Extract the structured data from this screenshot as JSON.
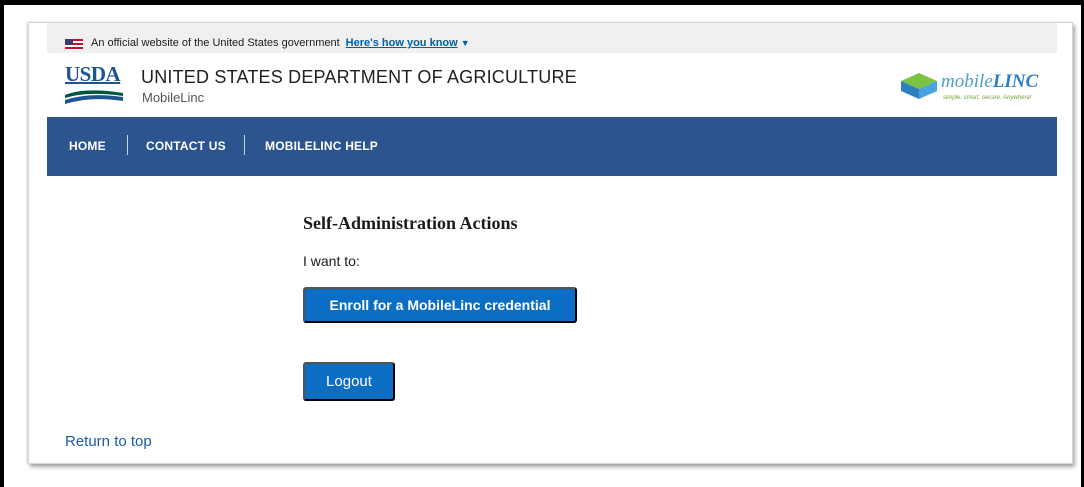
{
  "banner": {
    "text": "An official website of the United States government",
    "link": "Here's how you know",
    "flag_icon": "us-flag-icon"
  },
  "header": {
    "logo_text": "USDA",
    "agency_name": "UNITED STATES DEPARTMENT OF AGRICULTURE",
    "agency_sub": "MobileLinc",
    "brand_logo": {
      "name_part1": "mobile",
      "name_part2": "LINC",
      "tagline": "simple. smart. secure. Anywhere!"
    }
  },
  "nav": {
    "items": [
      {
        "label": "HOME"
      },
      {
        "label": "CONTACT US"
      },
      {
        "label": "MOBILELINC HELP"
      }
    ]
  },
  "main": {
    "title": "Self-Administration Actions",
    "prompt": "I want to:",
    "enroll_button": "Enroll for a MobileLinc credential",
    "logout_button": "Logout"
  },
  "footer": {
    "return_to_top": "Return to top"
  },
  "colors": {
    "nav_bg": "#2c5590",
    "button_bg": "#0b6ec2",
    "link": "#1a5aa8",
    "usda_blue": "#205493"
  }
}
